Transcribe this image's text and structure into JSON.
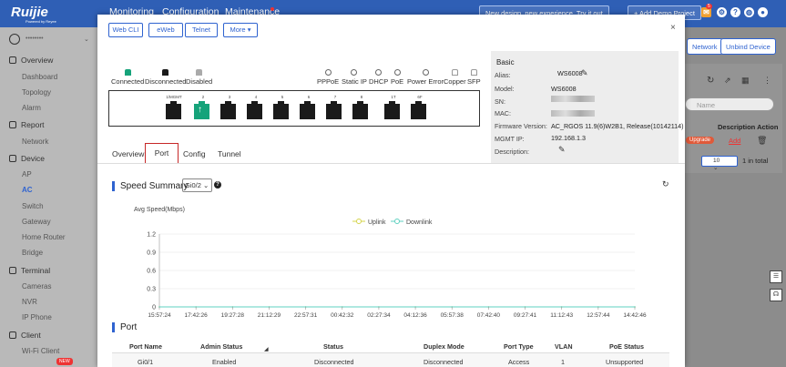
{
  "topbar": {
    "logo": "Ruijie",
    "logo_sub": "Powered by Reyee",
    "nav": [
      "Monitoring",
      "Configuration",
      "Maintenance"
    ],
    "new_design_btn": "New design, new experience. Try it out",
    "add_demo_btn": "+ Add Demo Project",
    "notif_count": "5"
  },
  "sidebar": {
    "user": "••••••••",
    "groups": [
      {
        "label": "Overview",
        "items": [
          "Dashboard",
          "Topology",
          "Alarm"
        ]
      },
      {
        "label": "Report",
        "items": [
          "Network"
        ]
      },
      {
        "label": "Device",
        "items": [
          "AP",
          "AC",
          "Switch",
          "Gateway",
          "Home Router",
          "Bridge"
        ]
      },
      {
        "label": "Terminal",
        "items": [
          "Cameras",
          "NVR",
          "IP Phone"
        ]
      },
      {
        "label": "Client",
        "items": [
          "Wi-Fi Client"
        ]
      }
    ],
    "active_item": "AC",
    "new_badge": "NEW"
  },
  "background": {
    "network_btn": "Network",
    "unbind_btn": "Unbind Device",
    "search_placeholder": "Name",
    "desc_action": "Description Action",
    "upgrade_badge": "Upgrade",
    "add_link": "Add",
    "page_size": "10",
    "total": "1 in total"
  },
  "modal": {
    "buttons": [
      "Web CLI",
      "eWeb",
      "Telnet",
      "More"
    ],
    "legend": [
      "Connected",
      "Disconnected",
      "Disabled"
    ],
    "port_types": [
      "PPPoE",
      "Static IP",
      "DHCP",
      "PoE",
      "Power Error",
      "Copper",
      "SFP"
    ],
    "port_numbers": [
      "1/MGMT",
      "2",
      "3",
      "4",
      "5",
      "6",
      "7",
      "8",
      "1T",
      "6F"
    ],
    "basic": {
      "title": "Basic",
      "rows": [
        {
          "key": "Alias:",
          "value": "WS6008"
        },
        {
          "key": "Model:",
          "value": "WS6008"
        },
        {
          "key": "SN:",
          "value": ""
        },
        {
          "key": "MAC:",
          "value": ""
        },
        {
          "key": "Firmware Version:",
          "value": "AC_RGOS 11.9(6)W2B1, Release(10142114)"
        },
        {
          "key": "MGMT IP:",
          "value": "192.168.1.3"
        },
        {
          "key": "Description:",
          "value": ""
        }
      ]
    },
    "tabs": [
      "Overview",
      "Port",
      "Config",
      "Tunnel"
    ],
    "active_tab": "Port",
    "speed_summary": {
      "title": "Speed Summary",
      "selected_port": "Gi0/2"
    },
    "port_section": {
      "title": "Port",
      "columns": [
        "Port Name",
        "Admin Status",
        "Status",
        "Duplex Mode",
        "Port Type",
        "VLAN",
        "PoE Status"
      ],
      "rows": [
        [
          "Gi0/1",
          "Enabled",
          "Disconnected",
          "Disconnected",
          "Access",
          "1",
          "Unsupported"
        ]
      ]
    }
  },
  "colors": {
    "uplink": "#d4d44a",
    "downlink": "#5fd0c0",
    "accent": "#2f63d0",
    "connected": "#16a37a"
  },
  "chart_data": {
    "type": "line",
    "ylabel": "Avg Speed(Mbps)",
    "ylim": [
      0,
      1.2
    ],
    "yticks": [
      0,
      0.3,
      0.6,
      0.9,
      1.2
    ],
    "x": [
      "15:57:24",
      "17:42:26",
      "19:27:28",
      "21:12:29",
      "22:57:31",
      "00:42:32",
      "02:27:34",
      "04:12:36",
      "05:57:38",
      "07:42:40",
      "09:27:41",
      "11:12:43",
      "12:57:44",
      "14:42:46"
    ],
    "series": [
      {
        "name": "Uplink",
        "values": [
          0,
          0,
          0,
          0,
          0,
          0,
          0,
          0,
          0,
          0,
          0,
          0,
          0,
          0
        ]
      },
      {
        "name": "Downlink",
        "values": [
          0,
          0,
          0,
          0,
          0,
          0,
          0,
          0,
          0,
          0,
          0,
          0,
          0,
          0
        ]
      }
    ],
    "legend": "top-center",
    "grid": true
  }
}
